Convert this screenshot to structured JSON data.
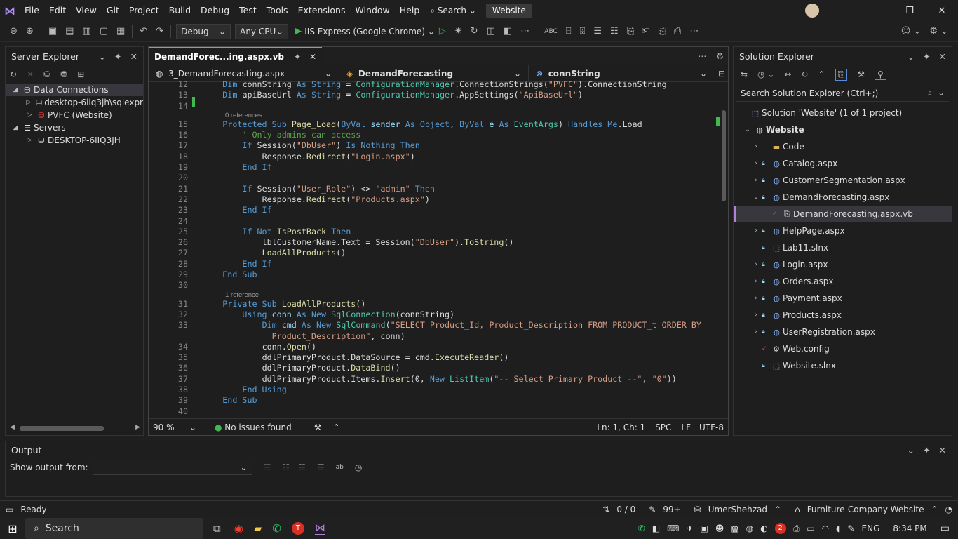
{
  "menubar": {
    "items": [
      "File",
      "Edit",
      "View",
      "Git",
      "Project",
      "Build",
      "Debug",
      "Test",
      "Tools",
      "Extensions",
      "Window",
      "Help"
    ],
    "search_label": "Search",
    "solution_badge": "Website"
  },
  "toolbar": {
    "config": "Debug",
    "platform": "Any CPU",
    "run_target": "IIS Express (Google Chrome)"
  },
  "server_explorer": {
    "title": "Server Explorer",
    "items": [
      {
        "label": "Data Connections",
        "level": 0,
        "expanded": true,
        "selected": true
      },
      {
        "label": "desktop-6iiq3jh\\sqlexpr",
        "level": 1,
        "expanded": false
      },
      {
        "label": "PVFC (Website)",
        "level": 1,
        "expanded": false
      },
      {
        "label": "Servers",
        "level": 0,
        "expanded": true
      },
      {
        "label": "DESKTOP-6IIQ3JH",
        "level": 1,
        "expanded": false
      }
    ]
  },
  "editor": {
    "tab_label": "DemandForec...ing.aspx.vb",
    "nav": {
      "file": "3_DemandForecasting.aspx",
      "class": "DemandForecasting",
      "member": "connString"
    },
    "zoom": "90 %",
    "issues": "No issues found",
    "position": "Ln: 1, Ch: 1",
    "whitespace": "SPC",
    "line_ending": "LF",
    "encoding": "UTF-8",
    "codelens": [
      "0 references",
      "1 reference"
    ]
  },
  "solution_explorer": {
    "title": "Solution Explorer",
    "search_placeholder": "Search Solution Explorer (Ctrl+;)",
    "solution_label": "Solution 'Website' (1 of 1 project)",
    "project": "Website",
    "items": [
      {
        "label": "Code",
        "type": "folder",
        "expand": "closed",
        "level": 1
      },
      {
        "label": "Catalog.aspx",
        "type": "aspx",
        "expand": "closed",
        "level": 1
      },
      {
        "label": "CustomerSegmentation.aspx",
        "type": "aspx",
        "expand": "closed",
        "level": 1
      },
      {
        "label": "DemandForecasting.aspx",
        "type": "aspx",
        "expand": "open",
        "level": 1
      },
      {
        "label": "DemandForecasting.aspx.vb",
        "type": "vb",
        "expand": "none",
        "level": 2,
        "selected": true
      },
      {
        "label": "HelpPage.aspx",
        "type": "aspx",
        "expand": "closed",
        "level": 1
      },
      {
        "label": "Lab11.slnx",
        "type": "slnx",
        "expand": "none",
        "level": 1
      },
      {
        "label": "Login.aspx",
        "type": "aspx",
        "expand": "closed",
        "level": 1
      },
      {
        "label": "Orders.aspx",
        "type": "aspx",
        "expand": "closed",
        "level": 1
      },
      {
        "label": "Payment.aspx",
        "type": "aspx",
        "expand": "closed",
        "level": 1
      },
      {
        "label": "Products.aspx",
        "type": "aspx",
        "expand": "closed",
        "level": 1
      },
      {
        "label": "UserRegistration.aspx",
        "type": "aspx",
        "expand": "closed",
        "level": 1
      },
      {
        "label": "Web.config",
        "type": "config",
        "expand": "none",
        "level": 1
      },
      {
        "label": "Website.slnx",
        "type": "slnx",
        "expand": "none",
        "level": 1
      }
    ]
  },
  "output": {
    "title": "Output",
    "show_from_label": "Show output from:",
    "show_from_value": ""
  },
  "status": {
    "ready": "Ready",
    "changes": "0 / 0",
    "edits": "99+",
    "user": "UmerShehzad",
    "repo": "Furniture-Company-Website"
  },
  "taskbar": {
    "search": "Search",
    "lang": "ENG",
    "time": "8:34 PM",
    "notif_count": "2"
  },
  "colors": {
    "accent": "#b180d7",
    "keyword": "#569cd6",
    "type": "#4ec9b0",
    "string": "#d69d85",
    "comment": "#57a64a"
  }
}
